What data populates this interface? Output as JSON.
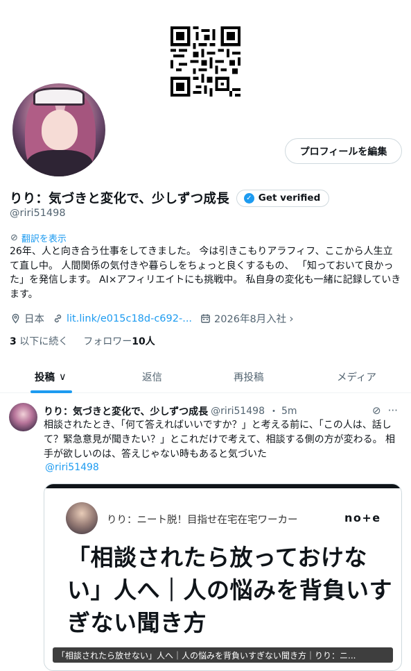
{
  "profile": {
    "display_name": "りり：気づきと変化で、少しずつ成長",
    "verify_label": "Get verified",
    "handle": "@riri51498",
    "edit_label": "プロフィールを編集",
    "translate_label": "翻訳を表示",
    "bio": "26年、人と向き合う仕事をしてきました。 今は引きこもりアラフィフ、ここから人生立て直し中。 人間関係の気付きや暮らしをちょっと良くするもの、 「知っておいて良かった」を発信します。 AI×アフィリエイトにも挑戦中。 私自身の変化も一緒に記録していきます。",
    "location": "日本",
    "link": "lit.link/e015c18d-c692-...",
    "joined": "2026年8月入社",
    "following_count": "3",
    "following_label": "以下に続く",
    "followers_label": "フォロワー",
    "followers_count": "10人"
  },
  "tabs": [
    {
      "label": "投稿",
      "chevron": "∨"
    },
    {
      "label": "返信"
    },
    {
      "label": "再投稿"
    },
    {
      "label": "メディア"
    }
  ],
  "post": {
    "name": "りり：気づきと変化で、少しずつ成長",
    "handle": "@riri51498",
    "separator": "・",
    "time": "5m",
    "text": "相談されたとき、「何て答えればいいですか？」と考える前に、「この人は、話して？緊急意見が聞きたい？」とこれだけで考えて、相談する側の方が変わる。 相手が欲しいのは、答えじゃない時もあると気づいた",
    "mention": "@riri51498",
    "card": {
      "author": "りり：ニート脱！目指せ在宅在宅ワーカー",
      "logo": "no+e",
      "title": "「相談されたら放っておけない」人へ｜人の悩みを背負いすぎない聞き方",
      "caption": "「相談されたら放せない」人へ｜人の悩みを背負いすぎない聞き方｜りり：ニ..."
    }
  },
  "icons": {
    "location": "location-pin-icon",
    "link": "link-icon",
    "calendar": "calendar-icon",
    "translate": "translate-icon",
    "verified": "verified-badge-icon"
  },
  "colors": {
    "accent": "#1d9bf0",
    "secondary_text": "#536471",
    "primary_text": "#0f1419"
  }
}
